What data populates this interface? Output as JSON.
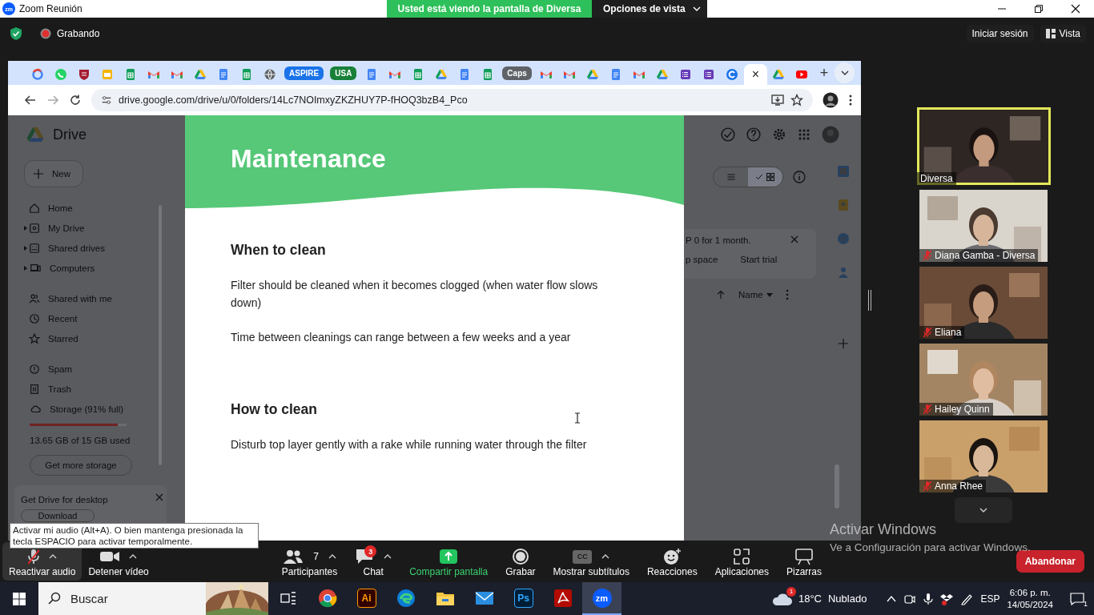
{
  "title_bar": {
    "app_badge": "zm",
    "title": "Zoom Reunión",
    "share_banner": "Usted está viendo la pantalla de Diversa",
    "view_options": "Opciones de vista"
  },
  "top_bar": {
    "recording": true,
    "recording_label": "Grabando",
    "sign_in": "Iniciar sesión",
    "view": "Vista"
  },
  "browser": {
    "tabs": [
      {
        "kind": "ring",
        "selected": false
      },
      {
        "kind": "chat",
        "selected": false
      },
      {
        "kind": "shield",
        "selected": false
      },
      {
        "kind": "slide",
        "selected": false
      },
      {
        "kind": "sheet",
        "selected": false
      },
      {
        "kind": "mail",
        "selected": false
      },
      {
        "kind": "mail",
        "selected": false
      },
      {
        "kind": "triangle",
        "selected": false
      },
      {
        "kind": "doc",
        "selected": false
      },
      {
        "kind": "sheet",
        "selected": false
      },
      {
        "kind": "globe",
        "selected": false
      },
      {
        "kind": "group",
        "label": "ASPIRE",
        "color": "#1a73e8",
        "selected": false
      },
      {
        "kind": "group",
        "label": "USA",
        "color": "#188038",
        "selected": false
      },
      {
        "kind": "doc",
        "selected": false
      },
      {
        "kind": "mail",
        "selected": false
      },
      {
        "kind": "sheet",
        "selected": false
      },
      {
        "kind": "triangle",
        "selected": false
      },
      {
        "kind": "doc",
        "selected": false
      },
      {
        "kind": "sheet",
        "selected": false
      },
      {
        "kind": "group",
        "label": "Caps",
        "color": "#5f6368",
        "selected": false
      },
      {
        "kind": "mail",
        "selected": false
      },
      {
        "kind": "mail",
        "selected": false
      },
      {
        "kind": "triangle",
        "selected": false
      },
      {
        "kind": "doc",
        "selected": false
      },
      {
        "kind": "mail",
        "selected": false
      },
      {
        "kind": "triangle",
        "selected": false
      },
      {
        "kind": "form",
        "selected": false
      },
      {
        "kind": "form",
        "selected": false
      },
      {
        "kind": "swirl",
        "selected": false
      },
      {
        "kind": "blank",
        "label": "×",
        "selected": true
      },
      {
        "kind": "triangle",
        "selected": false
      },
      {
        "kind": "play",
        "selected": false
      }
    ],
    "new_tab": "+",
    "url": "drive.google.com/drive/u/0/folders/14Lc7NOImxyZKZHUY7P-fHOQ3bzB4_Pco"
  },
  "drive": {
    "app_name": "Drive",
    "new_button": "New",
    "nav_sections": [
      [
        {
          "kind": "home",
          "label": "Home",
          "expandable": false
        },
        {
          "kind": "drive",
          "label": "My Drive",
          "expandable": true
        },
        {
          "kind": "shared-drives",
          "label": "Shared drives",
          "expandable": true
        },
        {
          "kind": "computer",
          "label": "Computers",
          "expandable": true
        }
      ],
      [
        {
          "kind": "people",
          "label": "Shared with me",
          "expandable": false
        },
        {
          "kind": "clock",
          "label": "Recent",
          "expandable": false
        },
        {
          "kind": "star",
          "label": "Starred",
          "expandable": false
        }
      ],
      [
        {
          "kind": "spam",
          "label": "Spam",
          "expandable": false
        },
        {
          "kind": "trash",
          "label": "Trash",
          "expandable": false
        },
        {
          "kind": "cloud",
          "label": "Storage (91% full)",
          "expandable": false
        }
      ]
    ],
    "storage": {
      "level": 0.91,
      "used": "13.65 GB of 15 GB used",
      "button": "Get more storage"
    },
    "desktop_promo": {
      "title": "Get Drive for desktop",
      "button": "Download"
    },
    "view_options": [
      {
        "kind": "list",
        "selected": false
      },
      {
        "kind": "grid",
        "selected": true
      }
    ],
    "banner": {
      "line_1": "P 0 for 1 month.",
      "line_2": "p space",
      "action": "Start trial"
    },
    "sort": {
      "label": "Name"
    }
  },
  "slide": {
    "title": "Maintenance",
    "sections": [
      {
        "heading": "When to clean",
        "paragraphs": [
          "Filter should be cleaned when it becomes clogged (when water flow slows down)",
          "Time between cleanings can range between a few weeks and a year"
        ]
      },
      {
        "heading": "How to clean",
        "paragraphs": [
          "Disturb top layer gently with a rake while running water through the filter"
        ]
      }
    ]
  },
  "gallery": [
    {
      "name": "Diversa",
      "speaking": true,
      "muted": false
    },
    {
      "name": "Diana Gamba - Diversa",
      "speaking": false,
      "muted": true
    },
    {
      "name": "Eliana",
      "speaking": false,
      "muted": true
    },
    {
      "name": "Hailey Quinn",
      "speaking": false,
      "muted": true
    },
    {
      "name": "Anna Rhee",
      "speaking": false,
      "muted": true
    }
  ],
  "tooltip": "Activar mi audio (Alt+A). O bien mantenga presionada la tecla ESPACIO para activar temporalmente.",
  "toolbar": [
    {
      "kind": "audio",
      "label": "Reactivar audio",
      "muted": true,
      "caret": true,
      "hovered": true
    },
    {
      "kind": "video",
      "label": "Detener vídeo",
      "caret": true,
      "hovered": false
    },
    {
      "kind": "participants",
      "label": "Participantes",
      "count": "7",
      "caret": true,
      "hovered": false
    },
    {
      "kind": "chat",
      "label": "Chat",
      "badge": "3",
      "caret": true,
      "hovered": false
    },
    {
      "kind": "share",
      "label": "Compartir pantalla",
      "caret": false,
      "hovered": false
    },
    {
      "kind": "record",
      "label": "Grabar",
      "caret": false,
      "hovered": false
    },
    {
      "kind": "captions",
      "label": "Mostrar subtítulos",
      "icon_text": "CC",
      "caret": true,
      "hovered": false
    },
    {
      "kind": "reactions",
      "label": "Reacciones",
      "caret": false,
      "hovered": false
    },
    {
      "kind": "apps",
      "label": "Aplicaciones",
      "caret": false,
      "hovered": false
    },
    {
      "kind": "whiteboards",
      "label": "Pizarras",
      "caret": false,
      "hovered": false
    }
  ],
  "leave_button": "Abandonar",
  "windows_activation": {
    "title": "Activar Windows",
    "message": "Ve a Configuración para activar Windows."
  },
  "taskbar": {
    "search_placeholder": "Buscar",
    "apps": [
      {
        "kind": "taskview",
        "selected": false
      },
      {
        "kind": "chrome",
        "selected": false
      },
      {
        "kind": "illustrator",
        "label": "Ai",
        "selected": false
      },
      {
        "kind": "edge",
        "selected": false
      },
      {
        "kind": "explorer",
        "selected": false
      },
      {
        "kind": "mail",
        "selected": false
      },
      {
        "kind": "photoshop",
        "label": "Ps",
        "selected": false
      },
      {
        "kind": "acrobat",
        "selected": false
      },
      {
        "kind": "zoom",
        "label": "zm",
        "selected": true
      }
    ],
    "weather": {
      "badge": "1",
      "temperature": "18°C",
      "condition": "Nublado"
    },
    "language": "ESP",
    "time": "6:06 p. m.",
    "date": "14/05/2024",
    "notifications": "1"
  }
}
